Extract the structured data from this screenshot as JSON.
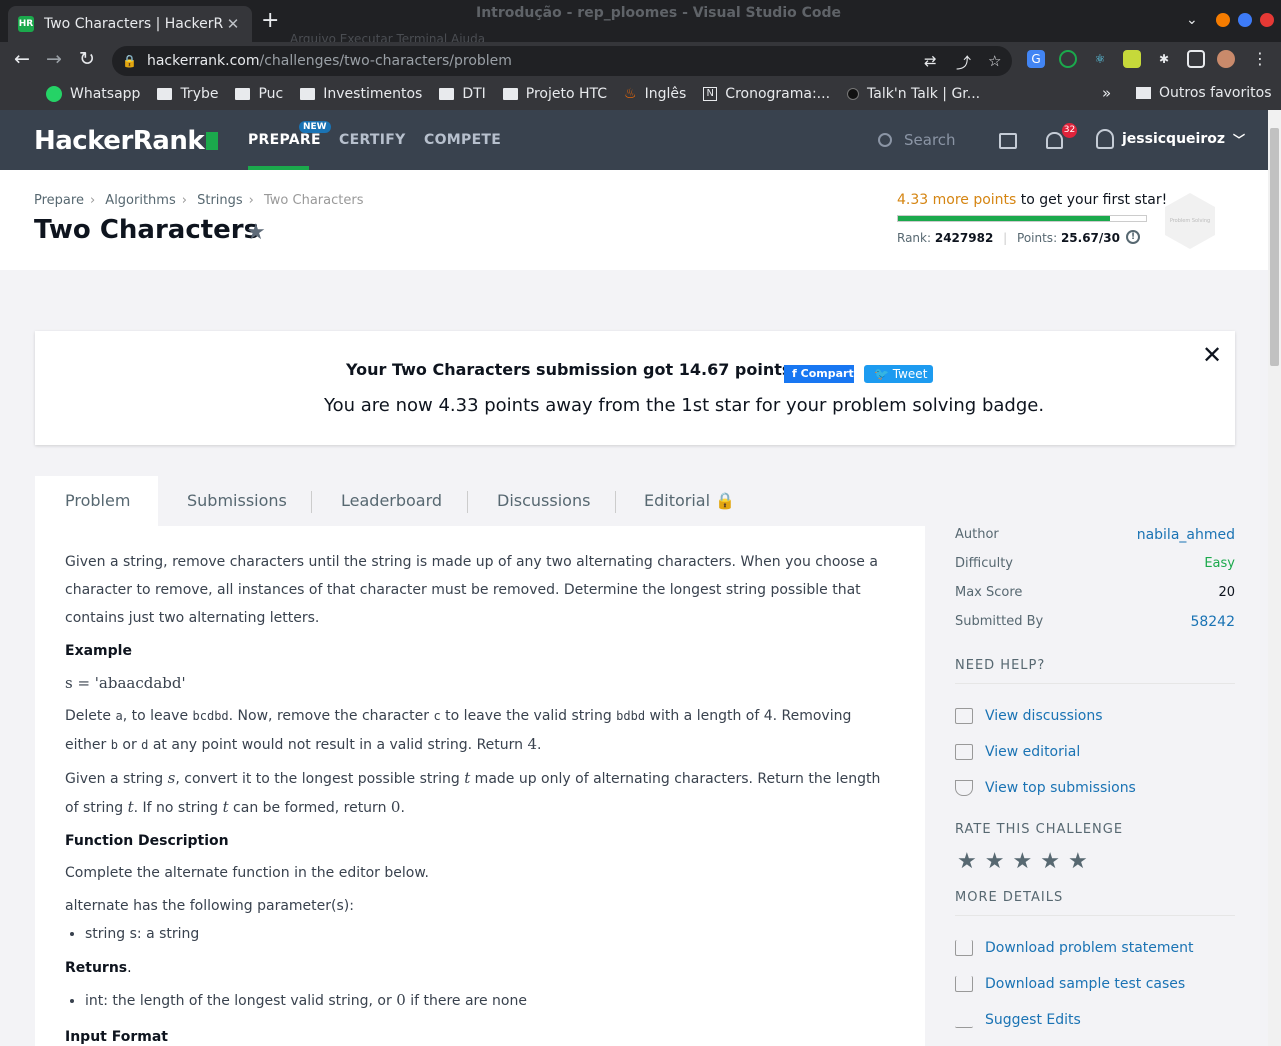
{
  "browser": {
    "tab_title": "Two Characters | HackerR...",
    "tab_favicon": "HR",
    "ghost_window_title": "Introdução - rep_ploomes - Visual Studio Code",
    "ghost_menu": "Arquivo   Executar   Terminal   Ajuda",
    "url_host": "hackerrank.com",
    "url_path": "/challenges/two-characters/problem",
    "bookmarks": [
      "Whatsapp",
      "Trybe",
      "Puc",
      "Investimentos",
      "DTI",
      "Projeto HTC",
      "Inglês",
      "Cronograma:...",
      "Talk'n Talk | Gr..."
    ],
    "more_bookmarks": "»",
    "other_bookmarks": "Outros favoritos"
  },
  "nav": {
    "logo": "HackerRank",
    "links": [
      "PREPARE",
      "CERTIFY",
      "COMPETE"
    ],
    "new_badge": "NEW",
    "search_placeholder": "Search",
    "notifications": "32",
    "username": "jessicqueiroz"
  },
  "header": {
    "breadcrumb": [
      "Prepare",
      "Algorithms",
      "Strings",
      "Two Characters"
    ],
    "title": "Two Characters",
    "points_needed": "4.33 more points",
    "points_suffix": " to get your first star!",
    "progress": 0.855,
    "rank_label": "Rank:",
    "rank": "2427982",
    "points_label": "Points:",
    "points": "25.67/30",
    "badge_label": "Problem Solving"
  },
  "banner": {
    "line1": "Your Two Characters submission got 14.67 points.",
    "share_fb": "Compartilhar",
    "share_tw": "Tweet",
    "line2": "You are now 4.33 points away from the 1st star for your problem solving badge."
  },
  "tabs": [
    "Problem",
    "Submissions",
    "Leaderboard",
    "Discussions",
    "Editorial"
  ],
  "problem": {
    "intro": "Given a string, remove characters until the string is made up of any two alternating characters. When you choose a character to remove, all instances of that character must be removed. Determine the longest string possible that contains just two alternating letters.",
    "example_h": "Example",
    "example_eq": "s = 'abaacdabd'",
    "delete_a": "Delete ",
    "delete_b": "a",
    "delete_c": ", to leave ",
    "delete_d": "bcdbd",
    "delete_e": ". Now, remove the character ",
    "delete_f": "c",
    "delete_g": " to leave the valid string ",
    "delete_h": "bdbd",
    "delete_i": " with a length of 4. Removing either ",
    "delete_j": "b",
    "delete_k": " or ",
    "delete_l": "d",
    "delete_m": " at any point would not result in a valid string. Return ",
    "delete_n": "4",
    "delete_o": ".",
    "given_a": "Given a string ",
    "given_b": "s",
    "given_c": ", convert it to the longest possible string ",
    "given_d": "t",
    "given_e": " made up only of alternating characters. Return the length of string ",
    "given_f": "t",
    "given_g": ". If no string ",
    "given_h": "t",
    "given_i": " can be formed, return ",
    "given_j": "0",
    "given_k": ".",
    "fd_h": "Function Description",
    "fd_1": "Complete the alternate function in the editor below.",
    "fd_2": "alternate has the following parameter(s):",
    "fd_param": "string s: a string",
    "ret_h": "Returns",
    "ret_dot": ".",
    "ret_a": "int: the length of the longest valid string, or ",
    "ret_b": "0",
    "ret_c": " if there are none",
    "input_h": "Input Format"
  },
  "sidebar": {
    "details": [
      {
        "k": "Author",
        "v": "nabila_ahmed"
      },
      {
        "k": "Difficulty",
        "v": "Easy"
      },
      {
        "k": "Max Score",
        "v": "20"
      },
      {
        "k": "Submitted By",
        "v": "58242"
      }
    ],
    "need_help": "NEED HELP?",
    "help_links": [
      "View discussions",
      "View editorial",
      "View top submissions"
    ],
    "rate": "RATE THIS CHALLENGE",
    "more": "MORE DETAILS",
    "more_links": [
      "Download problem statement",
      "Download sample test cases",
      "Suggest Edits"
    ]
  },
  "colors": {
    "brand_green": "#1ba94c",
    "nav_bg": "#39424e",
    "link_blue": "#1a73b4",
    "orange": "#d58512"
  }
}
